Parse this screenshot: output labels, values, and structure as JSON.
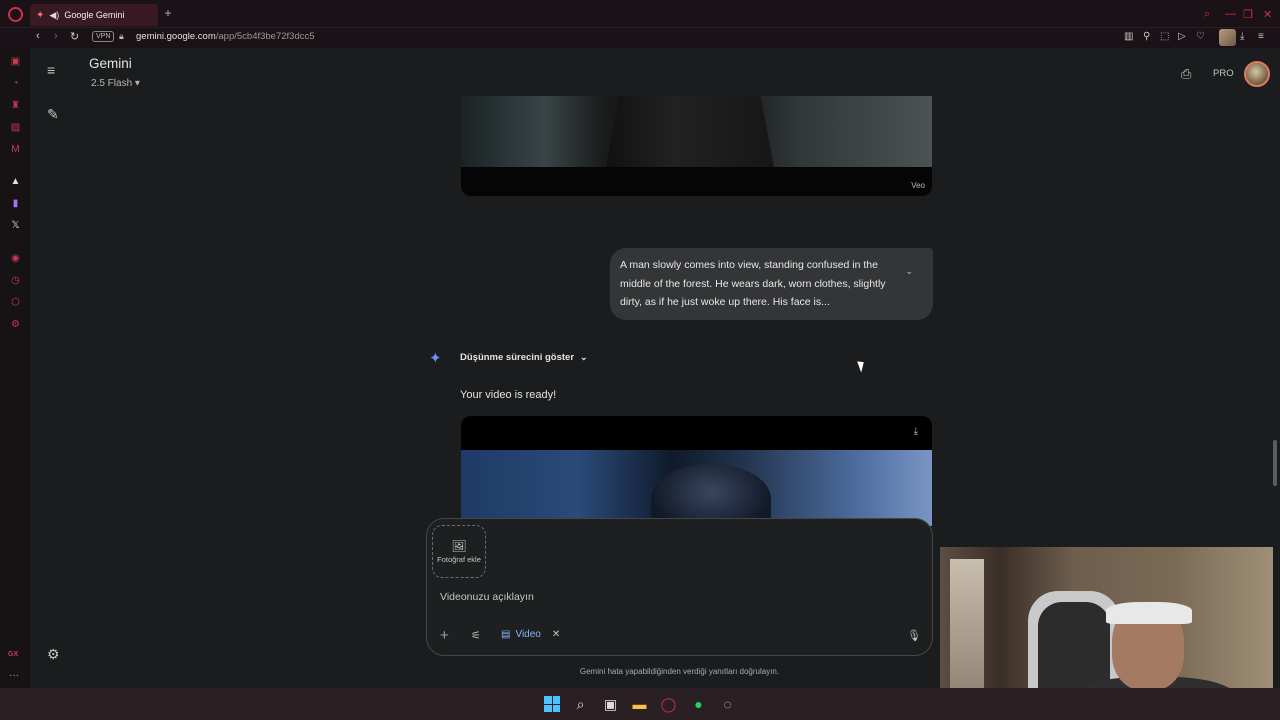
{
  "browser": {
    "tab_title": "Google Gemini",
    "url_domain": "gemini.google.com",
    "url_path": "/app/5cb4f3be72f3dcc5",
    "vpn_label": "VPN",
    "accent": "#d0304a"
  },
  "gemini": {
    "title": "Gemini",
    "model": "2.5 Flash",
    "pro_label": "PRO",
    "veo_watermark": "Veo",
    "user_message": "A man slowly comes into view, standing confused in the middle of the forest. He wears dark, worn clothes, slightly dirty, as if he just woke up there. His face is...",
    "thinking_label": "Düşünme sürecini göster",
    "reply_text": "Your video is ready!",
    "add_photo_label": "Fotoğraf ekle",
    "prompt_placeholder": "Videonuzu açıklayın",
    "video_chip_label": "Video",
    "disclaimer": "Gemini hata yapabildiğinden verdiği yanıtları doğrulayın.",
    "spark_color": "#6d8ef5",
    "chip_color": "#8ab4f8"
  },
  "opera_sidebar": {
    "gx_label": "GX"
  }
}
